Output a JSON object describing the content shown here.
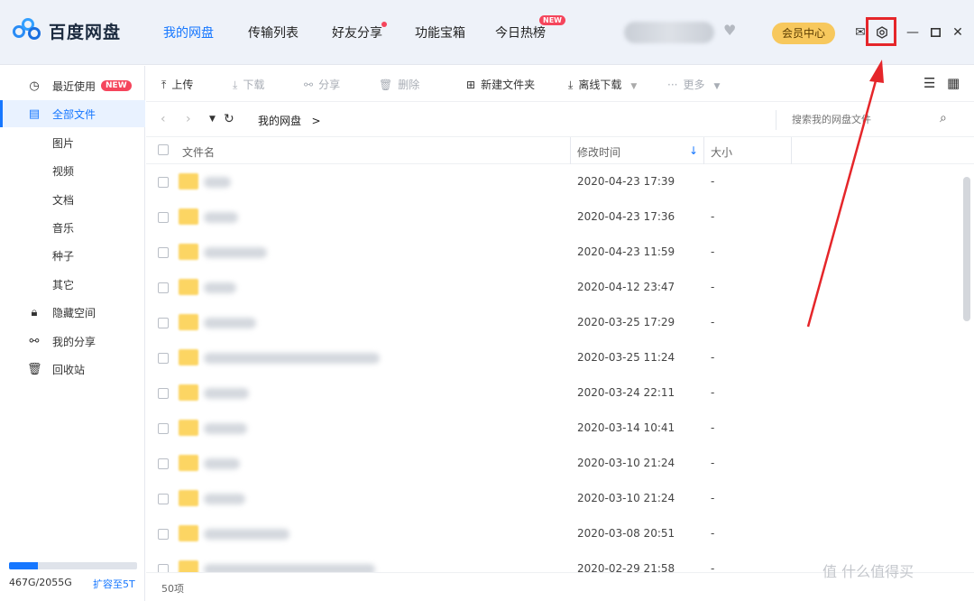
{
  "header": {
    "app_title": "百度网盘",
    "nav": [
      {
        "label": "我的网盘"
      },
      {
        "label": "传输列表"
      },
      {
        "label": "好友分享"
      },
      {
        "label": "功能宝箱"
      },
      {
        "label": "今日热榜",
        "badge": "NEW"
      }
    ],
    "vip_label": "会员中心",
    "icons": [
      "heart-icon",
      "mail-icon",
      "settings-icon",
      "minimize-icon",
      "maximize-icon",
      "close-icon"
    ]
  },
  "sidebar": {
    "items": [
      {
        "label": "最近使用",
        "icon": "clock-icon",
        "badge": "NEW"
      },
      {
        "label": "全部文件",
        "icon": "file-icon",
        "active": true
      },
      {
        "label": "图片"
      },
      {
        "label": "视频"
      },
      {
        "label": "文档"
      },
      {
        "label": "音乐"
      },
      {
        "label": "种子"
      },
      {
        "label": "其它"
      },
      {
        "label": "隐藏空间",
        "icon": "lock-icon"
      },
      {
        "label": "我的分享",
        "icon": "share-icon"
      },
      {
        "label": "回收站",
        "icon": "trash-icon"
      }
    ],
    "storage": {
      "text": "467G/2055G",
      "used_fraction": 0.227,
      "expand_label": "扩容至5T"
    }
  },
  "toolbar": {
    "upload": "上传",
    "download": "下载",
    "share": "分享",
    "delete": "删除",
    "new_folder": "新建文件夹",
    "offline_download": "离线下载",
    "more": "更多"
  },
  "address": {
    "crumb": "我的网盘",
    "separator": ">",
    "search_placeholder": "搜索我的网盘文件"
  },
  "table": {
    "col_name": "文件名",
    "col_mtime": "修改时间",
    "col_size": "大小",
    "rows": [
      {
        "mtime": "2020-04-23 17:39",
        "size": "-"
      },
      {
        "mtime": "2020-04-23 17:36",
        "size": "-"
      },
      {
        "mtime": "2020-04-23 11:59",
        "size": "-"
      },
      {
        "mtime": "2020-04-12 23:47",
        "size": "-"
      },
      {
        "mtime": "2020-03-25 17:29",
        "size": "-"
      },
      {
        "mtime": "2020-03-25 11:24",
        "size": "-"
      },
      {
        "mtime": "2020-03-24 22:11",
        "size": "-"
      },
      {
        "mtime": "2020-03-14 10:41",
        "size": "-"
      },
      {
        "mtime": "2020-03-10 21:24",
        "size": "-"
      },
      {
        "mtime": "2020-03-10 21:24",
        "size": "-"
      },
      {
        "mtime": "2020-03-08 20:51",
        "size": "-"
      },
      {
        "mtime": "2020-02-29 21:58",
        "size": "-"
      }
    ]
  },
  "status": {
    "count": "50项"
  },
  "watermark": "值 什么值得买",
  "colors": {
    "accent": "#1677ff",
    "badge": "#f5455c",
    "vip": "#f7c85d",
    "annotation": "#e5262a"
  }
}
